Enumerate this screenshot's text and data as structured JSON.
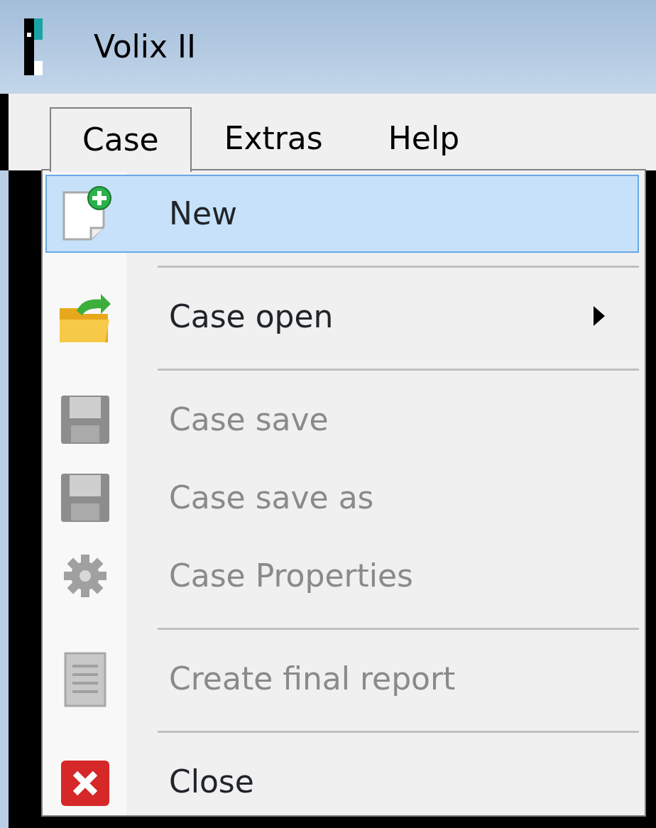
{
  "window": {
    "title": "Volix II"
  },
  "menu_bar": [
    {
      "label": "Case",
      "selected": true
    },
    {
      "label": "Extras",
      "selected": false
    },
    {
      "label": "Help",
      "selected": false
    }
  ],
  "menu": [
    {
      "kind": "item",
      "label": "New",
      "selected": true,
      "disabled": false,
      "submenu": false
    },
    {
      "kind": "separator"
    },
    {
      "kind": "item",
      "label": "Case open",
      "selected": false,
      "disabled": false,
      "submenu": true
    },
    {
      "kind": "separator"
    },
    {
      "kind": "item",
      "label": "Case save",
      "selected": false,
      "disabled": true,
      "submenu": false
    },
    {
      "kind": "item",
      "label": "Case save as",
      "selected": false,
      "disabled": true,
      "submenu": false
    },
    {
      "kind": "item",
      "label": "Case Properties",
      "selected": false,
      "disabled": true,
      "submenu": false
    },
    {
      "kind": "separator"
    },
    {
      "kind": "item",
      "label": "Create final report",
      "selected": false,
      "disabled": true,
      "submenu": false
    },
    {
      "kind": "separator"
    },
    {
      "kind": "item",
      "label": "Close",
      "selected": false,
      "disabled": false,
      "submenu": false
    }
  ]
}
